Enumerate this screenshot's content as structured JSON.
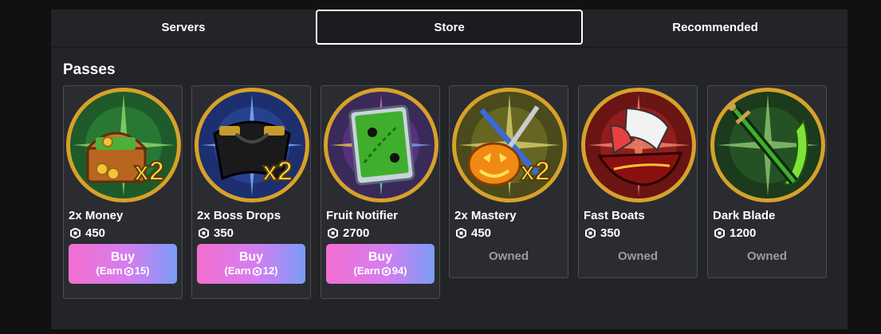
{
  "tabs": [
    {
      "label": "Servers"
    },
    {
      "label": "Store"
    },
    {
      "label": "Recommended"
    }
  ],
  "section": {
    "title": "Passes"
  },
  "passes": [
    {
      "name": "2x Money",
      "price": "450",
      "status": "buy",
      "buy_label": "Buy",
      "earn_prefix": "(Earn",
      "earn_value": "15)",
      "icon": "treasure-chest-icon"
    },
    {
      "name": "2x Boss Drops",
      "price": "350",
      "status": "buy",
      "buy_label": "Buy",
      "earn_prefix": "(Earn",
      "earn_value": "12)",
      "icon": "cape-icon"
    },
    {
      "name": "Fruit Notifier",
      "price": "2700",
      "status": "buy",
      "buy_label": "Buy",
      "earn_prefix": "(Earn",
      "earn_value": "94)",
      "icon": "map-book-icon"
    },
    {
      "name": "2x Mastery",
      "price": "450",
      "status": "owned",
      "owned_label": "Owned",
      "icon": "pumpkin-swords-icon"
    },
    {
      "name": "Fast Boats",
      "price": "350",
      "status": "owned",
      "owned_label": "Owned",
      "icon": "ship-icon"
    },
    {
      "name": "Dark Blade",
      "price": "1200",
      "status": "owned",
      "owned_label": "Owned",
      "icon": "green-sword-icon"
    }
  ],
  "badge_text": "x2",
  "colors": {
    "background": "#111112",
    "panel": "#232428",
    "card": "#2a2c31",
    "card_border": "#4b4d52",
    "buy_gradient_start": "#f36fd0",
    "buy_gradient_end": "#7a9cf6",
    "owned_text": "#9a9ca1",
    "ring_gold": "#d7a12a"
  }
}
